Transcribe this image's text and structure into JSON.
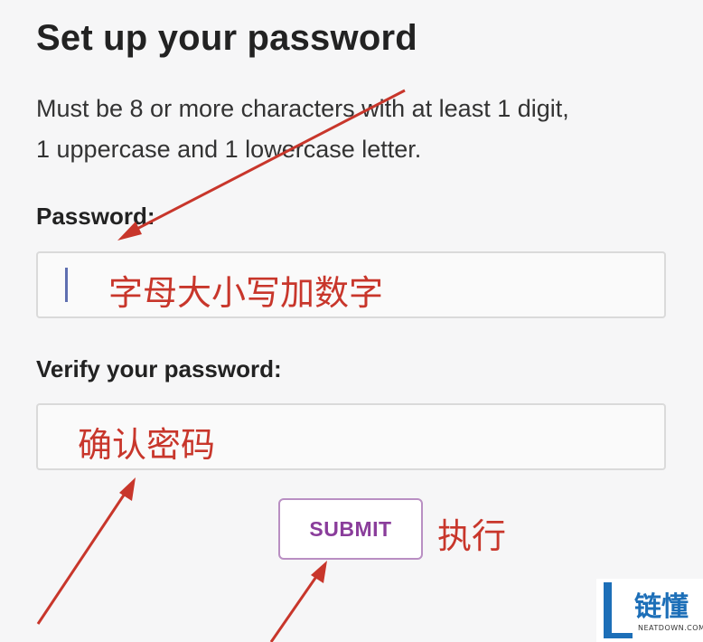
{
  "title": "Set up your password",
  "instructions": {
    "line1": "Must be 8 or more characters with at least 1 digit,",
    "line2": "1 uppercase and 1 lowercase letter."
  },
  "password": {
    "label": "Password:",
    "annotation": "字母大小写加数字"
  },
  "verify": {
    "label": "Verify your password:",
    "annotation": "确认密码"
  },
  "submit": {
    "label": "SUBMIT",
    "annotation": "执行"
  },
  "watermark": {
    "name": "链懂",
    "site": "NEATDOWN.COM"
  },
  "colors": {
    "annotation_red": "#c8362b",
    "button_purple": "#8a3d9b",
    "watermark_blue": "#1d6fb8"
  },
  "icons": [
    "red-arrow-icon",
    "watermark-logo-icon"
  ]
}
